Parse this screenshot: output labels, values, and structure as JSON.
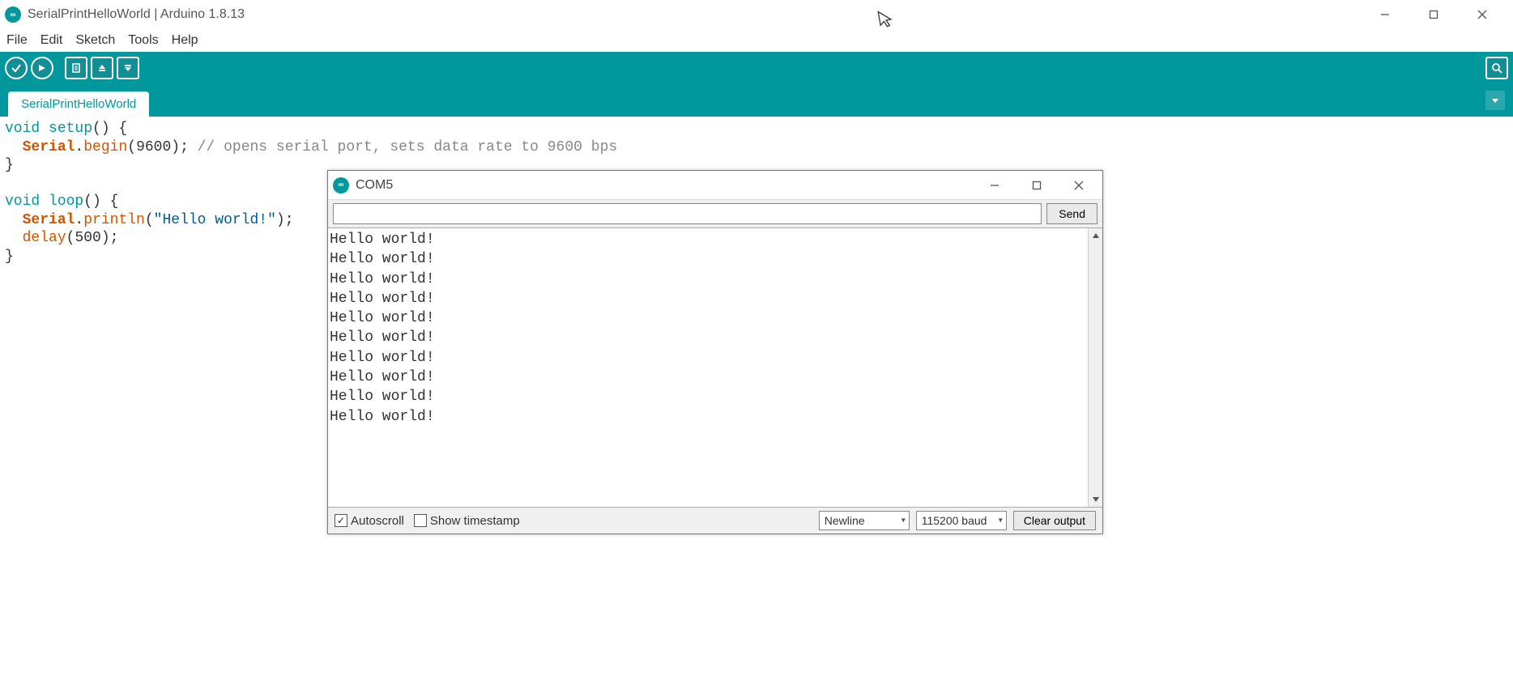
{
  "titlebar": {
    "title": "SerialPrintHelloWorld | Arduino 1.8.13"
  },
  "menubar": {
    "items": [
      "File",
      "Edit",
      "Sketch",
      "Tools",
      "Help"
    ]
  },
  "toolbar": {
    "icons": [
      "verify",
      "upload",
      "new",
      "open",
      "save"
    ],
    "search_icon": "serial-monitor"
  },
  "tabbar": {
    "tab": "SerialPrintHelloWorld"
  },
  "code": {
    "line1_a": "void",
    "line1_b": " setup",
    "line1_c": "() {",
    "line2_a": "  ",
    "line2_b": "Serial",
    "line2_c": ".",
    "line2_d": "begin",
    "line2_e": "(",
    "line2_f": "9600",
    "line2_g": "); ",
    "line2_h": "// opens serial port, sets data rate to 9600 bps",
    "line3": "}",
    "line4": "",
    "line5_a": "void",
    "line5_b": " loop",
    "line5_c": "() {",
    "line6_a": "  ",
    "line6_b": "Serial",
    "line6_c": ".",
    "line6_d": "println",
    "line6_e": "(",
    "line6_f": "\"Hello world!\"",
    "line6_g": ");",
    "line7_a": "  ",
    "line7_b": "delay",
    "line7_c": "(",
    "line7_d": "500",
    "line7_e": ");",
    "line8": "}"
  },
  "serial": {
    "title": "COM5",
    "send": "Send",
    "input_value": "",
    "output_lines": [
      "Hello world!",
      "Hello world!",
      "Hello world!",
      "Hello world!",
      "Hello world!",
      "Hello world!",
      "Hello world!",
      "Hello world!",
      "Hello world!",
      "Hello world!"
    ],
    "autoscroll_label": "Autoscroll",
    "autoscroll_checked": true,
    "timestamp_label": "Show timestamp",
    "timestamp_checked": false,
    "line_ending": "Newline",
    "baud": "115200 baud",
    "clear": "Clear output"
  }
}
